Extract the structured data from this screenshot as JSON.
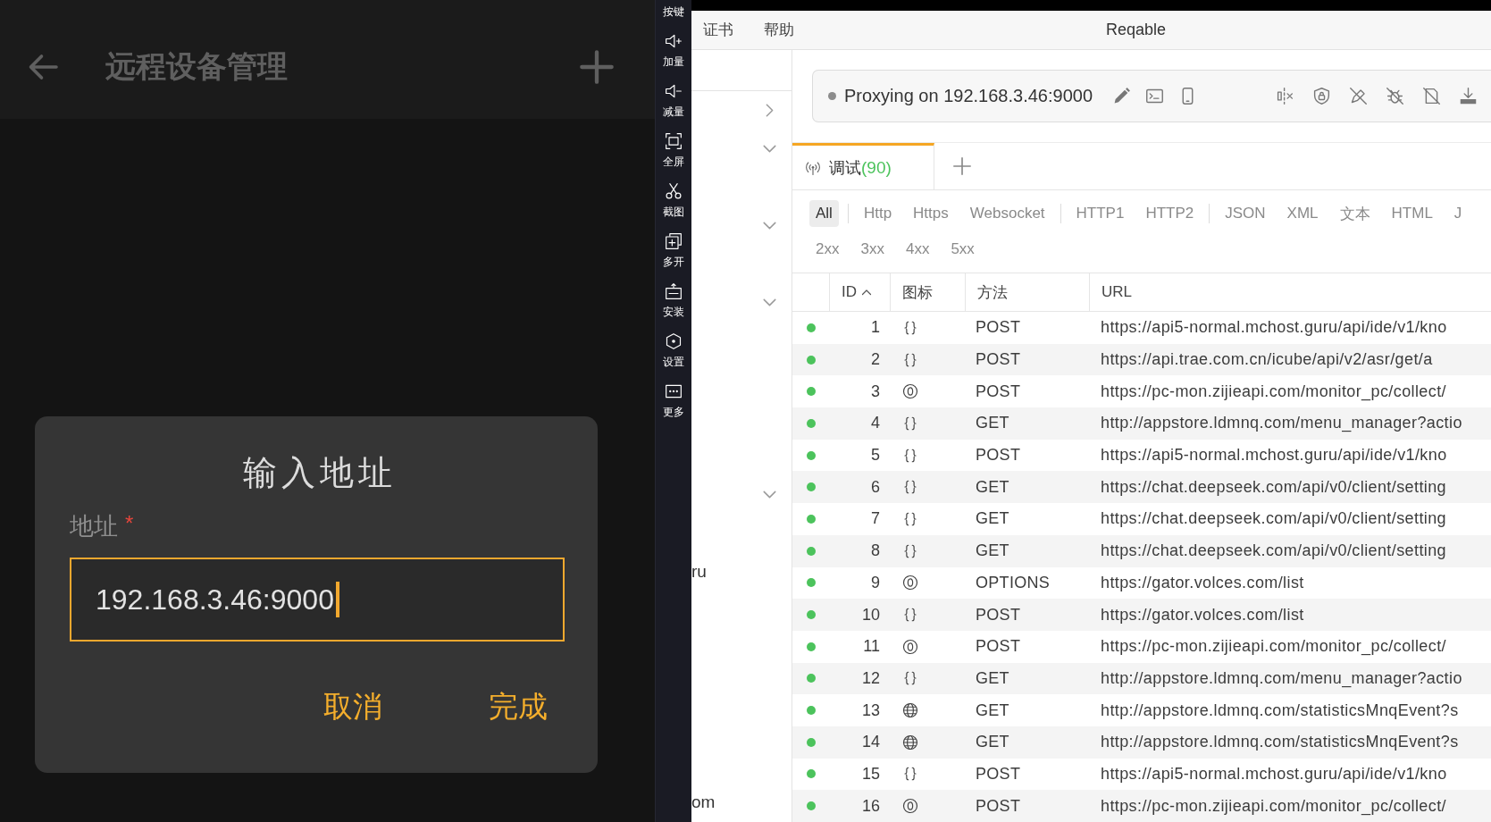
{
  "phone": {
    "app_bar": {
      "title": "远程设备管理"
    },
    "dialog": {
      "title": "输入地址",
      "field": {
        "label": "地址",
        "required_mark": "*",
        "value": "192.168.3.46:9000",
        "focused": true
      },
      "buttons": [
        {
          "label": "取消"
        },
        {
          "label": "完成"
        }
      ]
    }
  },
  "emulator_toolbar": {
    "items": [
      {
        "kind": "keys",
        "label": "按键"
      },
      {
        "kind": "volume-up",
        "label": "加量"
      },
      {
        "kind": "volume-down",
        "label": "减量"
      },
      {
        "kind": "fullscreen",
        "label": "全屏"
      },
      {
        "kind": "screenshot",
        "label": "截图"
      },
      {
        "kind": "multi-instance",
        "label": "多开"
      },
      {
        "kind": "install",
        "label": "安装"
      },
      {
        "kind": "settings",
        "label": "设置"
      },
      {
        "kind": "more",
        "label": "更多"
      }
    ]
  },
  "reqable": {
    "menu": [
      "证书",
      "帮助"
    ],
    "window": {
      "title": "Reqable"
    },
    "sidebar": {
      "items": [
        {
          "kind": "group",
          "expanded": false
        },
        {
          "kind": "group",
          "expanded": true
        },
        {
          "kind": "group",
          "expanded": true
        },
        {
          "kind": "group",
          "expanded": true
        },
        {
          "kind": "group",
          "expanded": true
        },
        {
          "kind": "host",
          "label": "ru"
        },
        {
          "kind": "host",
          "label": "om"
        }
      ]
    },
    "proxy_bar": {
      "status": "Proxying on 192.168.3.46:9000"
    },
    "tabs": [
      {
        "label": "调试",
        "count": "(90)",
        "selected": true
      }
    ],
    "filters": {
      "groups": [
        {
          "items": [
            {
              "label": "All",
              "selected": true
            }
          ]
        },
        {
          "items": [
            {
              "label": "Http",
              "selected": false
            },
            {
              "label": "Https",
              "selected": false
            },
            {
              "label": "Websocket",
              "selected": false
            }
          ]
        },
        {
          "items": [
            {
              "label": "HTTP1",
              "selected": false
            },
            {
              "label": "HTTP2",
              "selected": false
            }
          ]
        },
        {
          "items": [
            {
              "label": "JSON",
              "selected": false
            },
            {
              "label": "XML",
              "selected": false
            },
            {
              "label": "文本",
              "selected": false
            },
            {
              "label": "HTML",
              "selected": false
            },
            {
              "label": "J",
              "selected": false
            }
          ]
        }
      ],
      "status_codes": [
        {
          "label": "2xx",
          "selected": false
        },
        {
          "label": "3xx",
          "selected": false
        },
        {
          "label": "4xx",
          "selected": false
        },
        {
          "label": "5xx",
          "selected": false
        }
      ]
    },
    "table": {
      "columns": [
        {
          "label": "ID",
          "sorted": true
        },
        {
          "label": "图标",
          "sorted": false
        },
        {
          "label": "方法",
          "sorted": false
        },
        {
          "label": "URL",
          "sorted": false
        }
      ],
      "rows": [
        {
          "color": "#4cc35c",
          "id": "1",
          "kind": "json",
          "method": "POST",
          "url": "https://api5-normal.mchost.guru/api/ide/v1/kno"
        },
        {
          "color": "#4cc35c",
          "id": "2",
          "kind": "json",
          "method": "POST",
          "url": "https://api.trae.com.cn/icube/api/v2/asr/get/a"
        },
        {
          "color": "#4cc35c",
          "id": "3",
          "kind": "other",
          "method": "POST",
          "url": "https://pc-mon.zijieapi.com/monitor_pc/collect/"
        },
        {
          "color": "#4cc35c",
          "id": "4",
          "kind": "json",
          "method": "GET",
          "url": "http://appstore.ldmnq.com/menu_manager?actio"
        },
        {
          "color": "#4cc35c",
          "id": "5",
          "kind": "json",
          "method": "POST",
          "url": "https://api5-normal.mchost.guru/api/ide/v1/kno"
        },
        {
          "color": "#4cc35c",
          "id": "6",
          "kind": "json",
          "method": "GET",
          "url": "https://chat.deepseek.com/api/v0/client/setting"
        },
        {
          "color": "#4cc35c",
          "id": "7",
          "kind": "json",
          "method": "GET",
          "url": "https://chat.deepseek.com/api/v0/client/setting"
        },
        {
          "color": "#4cc35c",
          "id": "8",
          "kind": "json",
          "method": "GET",
          "url": "https://chat.deepseek.com/api/v0/client/setting"
        },
        {
          "color": "#4cc35c",
          "id": "9",
          "kind": "other",
          "method": "OPTIONS",
          "url": "https://gator.volces.com/list"
        },
        {
          "color": "#4cc35c",
          "id": "10",
          "kind": "json",
          "method": "POST",
          "url": "https://gator.volces.com/list"
        },
        {
          "color": "#4cc35c",
          "id": "11",
          "kind": "other",
          "method": "POST",
          "url": "https://pc-mon.zijieapi.com/monitor_pc/collect/"
        },
        {
          "color": "#4cc35c",
          "id": "12",
          "kind": "json",
          "method": "GET",
          "url": "http://appstore.ldmnq.com/menu_manager?actio"
        },
        {
          "color": "#4cc35c",
          "id": "13",
          "kind": "web",
          "method": "GET",
          "url": "http://appstore.ldmnq.com/statisticsMnqEvent?s"
        },
        {
          "color": "#4cc35c",
          "id": "14",
          "kind": "web",
          "method": "GET",
          "url": "http://appstore.ldmnq.com/statisticsMnqEvent?s"
        },
        {
          "color": "#4cc35c",
          "id": "15",
          "kind": "json",
          "method": "POST",
          "url": "https://api5-normal.mchost.guru/api/ide/v1/kno"
        },
        {
          "color": "#4cc35c",
          "id": "16",
          "kind": "other",
          "method": "POST",
          "url": "https://pc-mon.zijieapi.com/monitor_pc/collect/"
        }
      ]
    }
  }
}
